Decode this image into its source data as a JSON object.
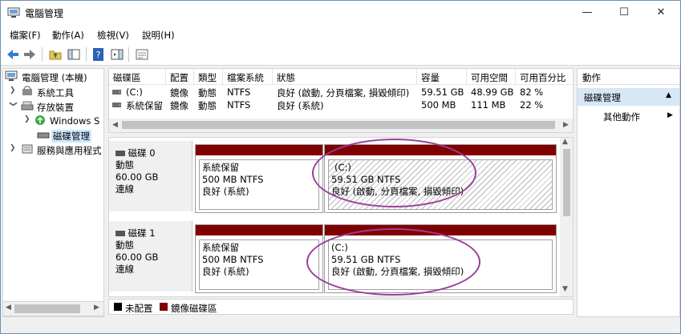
{
  "window": {
    "title": "電腦管理"
  },
  "caption_buttons": {
    "minimize": "—",
    "maximize": "☐",
    "close": "✕"
  },
  "menu": [
    "檔案(F)",
    "動作(A)",
    "檢視(V)",
    "說明(H)"
  ],
  "tree": {
    "items": [
      {
        "label": "電腦管理 (本機)",
        "icon": "computer-management-icon"
      },
      {
        "label": "系統工具",
        "icon": "system-tools-icon"
      },
      {
        "label": "存放裝置",
        "icon": "storage-icon"
      },
      {
        "label": "Windows S",
        "icon": "windows-backup-icon"
      },
      {
        "label": "磁碟管理",
        "icon": "disk-management-icon"
      },
      {
        "label": "服務與應用程式",
        "icon": "services-icon"
      }
    ]
  },
  "volume_list": {
    "columns": [
      "磁碟區",
      "配置",
      "類型",
      "檔案系統",
      "狀態",
      "容量",
      "可用空間",
      "可用百分比"
    ],
    "rows": [
      [
        "(C:)",
        "鏡像",
        "動態",
        "NTFS",
        "良好 (啟動, 分頁檔案, 損毀傾印)",
        "59.51 GB",
        "48.99 GB",
        "82 %"
      ],
      [
        "系統保留",
        "鏡像",
        "動態",
        "NTFS",
        "良好 (系統)",
        "500 MB",
        "111 MB",
        "22 %"
      ]
    ]
  },
  "disks": [
    {
      "name": "磁碟 0",
      "type": "動態",
      "size": "60.00 GB",
      "status": "連線",
      "partitions": [
        {
          "name": "系統保留",
          "detail": "500 MB NTFS",
          "status": "良好 (系統)"
        },
        {
          "name": "(C:)",
          "detail": "59.51 GB NTFS",
          "status": "良好 (啟動, 分頁檔案, 損毀傾印)"
        }
      ]
    },
    {
      "name": "磁碟 1",
      "type": "動態",
      "size": "60.00 GB",
      "status": "連線",
      "partitions": [
        {
          "name": "系統保留",
          "detail": "500 MB NTFS",
          "status": "良好 (系統)"
        },
        {
          "name": "(C:)",
          "detail": "59.51 GB NTFS",
          "status": "良好 (啟動, 分頁檔案, 損毀傾印)"
        }
      ]
    }
  ],
  "legend": [
    {
      "label": "未配置",
      "color": "#000000"
    },
    {
      "label": "鏡像磁碟區",
      "color": "#800000"
    }
  ],
  "actions": {
    "header": "動作",
    "section": "磁碟管理",
    "more": "其他動作"
  },
  "colors": {
    "mirror": "#800000",
    "annotation": "#9a3f9a",
    "selection": "#cce8ff"
  }
}
